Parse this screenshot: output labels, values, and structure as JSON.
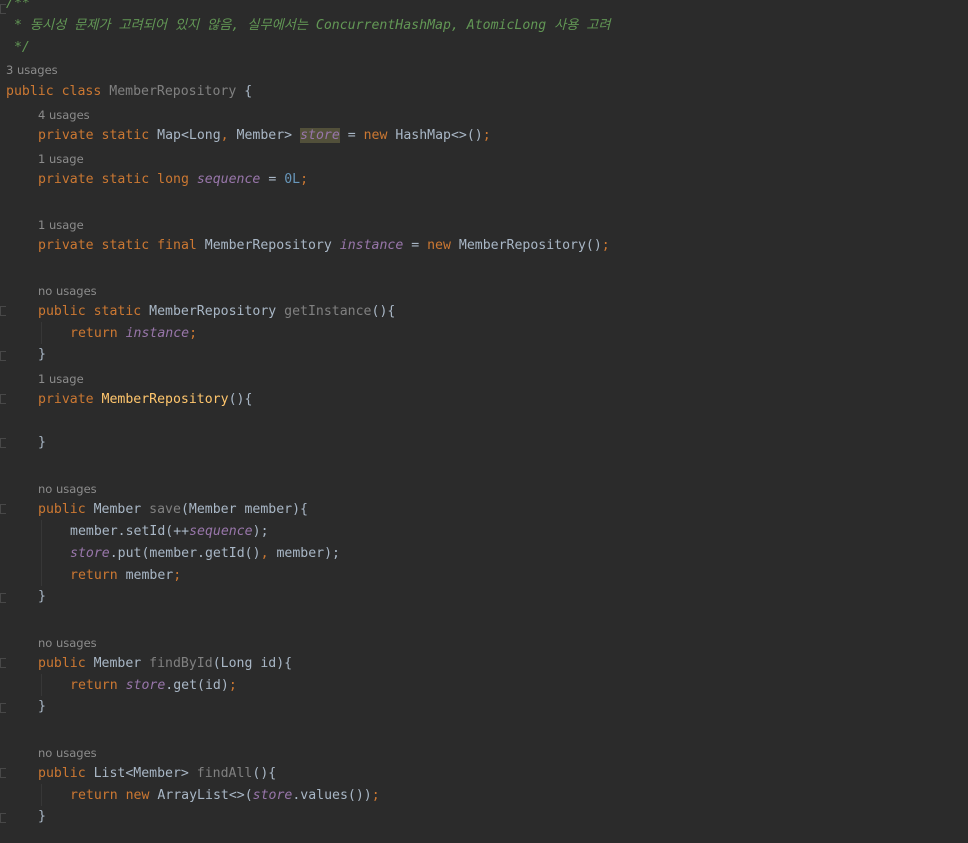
{
  "code": {
    "comment_open": "/**",
    "comment_body": " * 동시성 문제가 고려되어 있지 않음, 실무에서는 ConcurrentHashMap, AtomicLong 사용 고려",
    "comment_close": " */",
    "class_hint": "3 usages",
    "kw_public": "public",
    "kw_class": "class",
    "class_name": "MemberRepository",
    "brace_open": " {",
    "store_hint": "4 usages",
    "kw_private": "private",
    "kw_static": "static",
    "store_type": "Map<Long",
    "comma": ",",
    "store_type2": " Member> ",
    "store_name": "store",
    "assign": " = ",
    "kw_new": "new",
    "store_init": " HashMap<>()",
    "semi": ";",
    "seq_hint": "1 usage",
    "kw_long": "long",
    "seq_name": "sequence",
    "seq_value": "0L",
    "inst_hint": "1 usage",
    "kw_final": "final",
    "inst_type": " MemberRepository ",
    "inst_name": "instance",
    "inst_init": " MemberRepository()",
    "getinst_hint": "no usages",
    "getinst_type": " MemberRepository ",
    "getinst_name": "getInstance",
    "parens_open": "(){",
    "kw_return": "return",
    "close_brace": "}",
    "ctor_hint": "1 usage",
    "ctor_name": "MemberRepository",
    "save_hint": "no usages",
    "type_member": " Member ",
    "save_name": "save",
    "save_params": "(Member member){",
    "save_l1a": "member.setId(++",
    "save_l1b": ");",
    "save_l2a": ".put(member.getId()",
    "save_l2b": " member);",
    "save_l3": " member",
    "find_hint": "no usages",
    "find_name": "findById",
    "find_params": "(Long id){",
    "find_ret": ".get(id)",
    "findall_hint": "no usages",
    "findall_type": " List<Member> ",
    "findall_name": "findAll",
    "findall_ret_a": " ArrayList<>(",
    "findall_ret_b": ".values())"
  }
}
